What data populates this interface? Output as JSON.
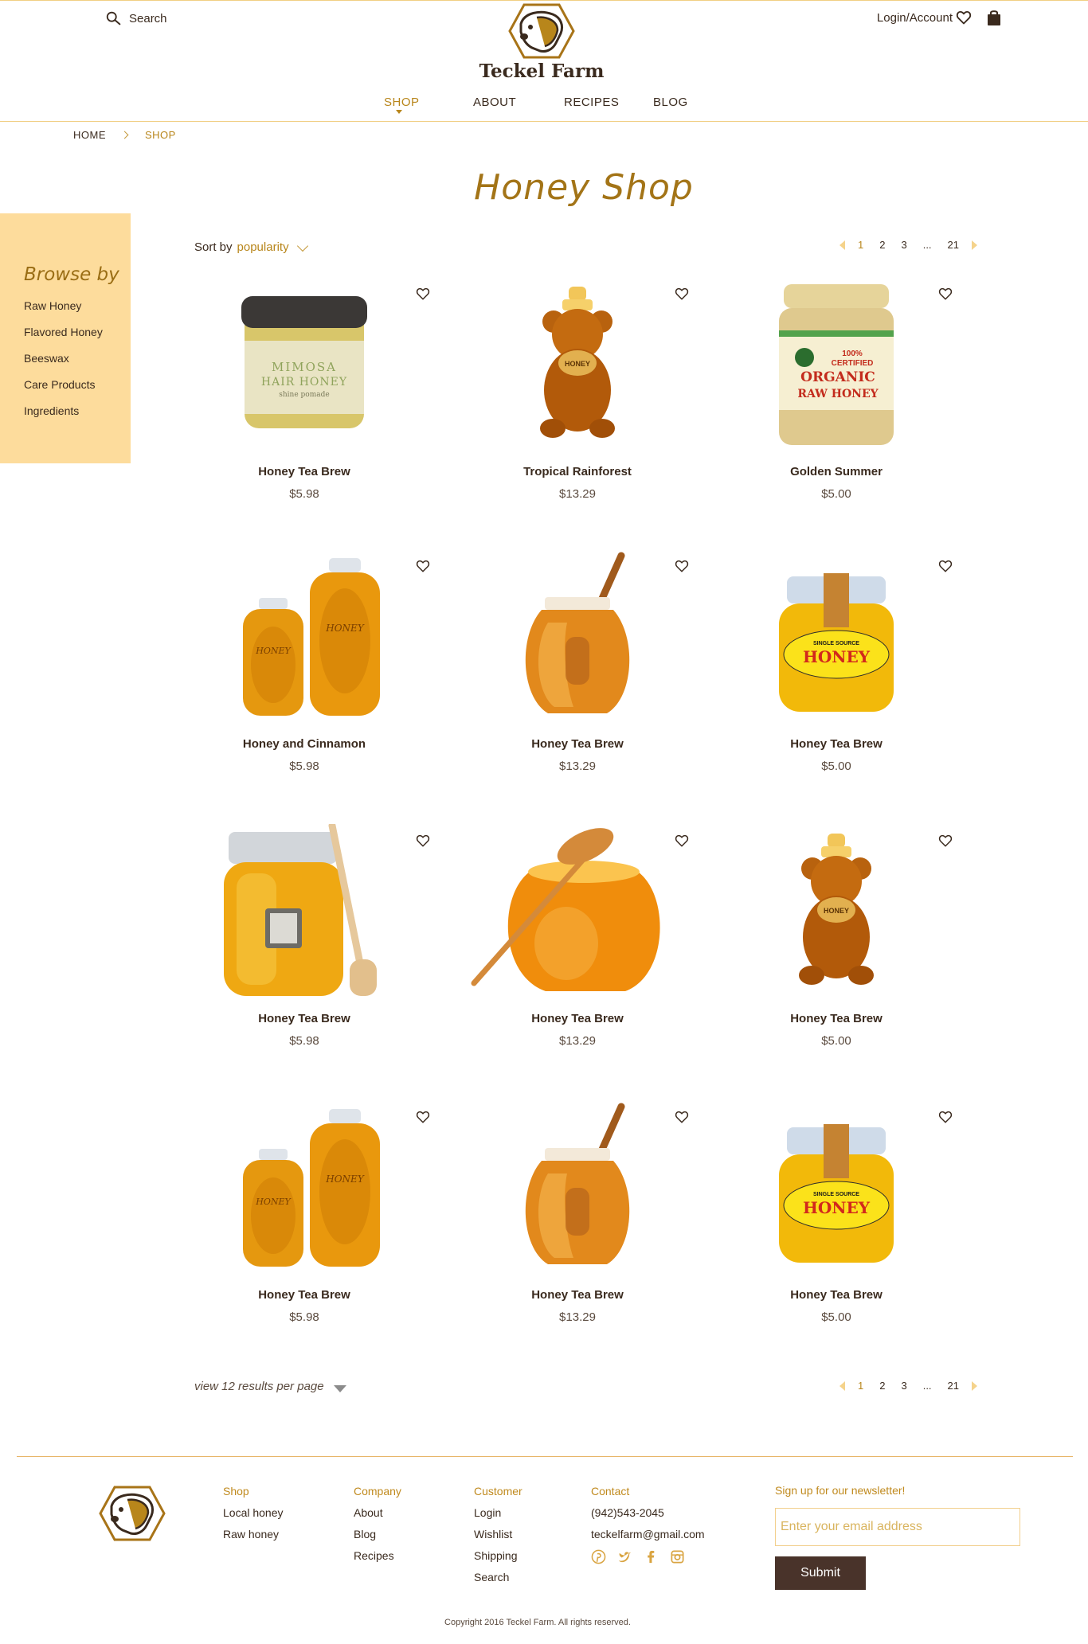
{
  "header": {
    "search_label": "Search",
    "brand": "Teckel Farm",
    "account_label": "Login/Account"
  },
  "nav": [
    {
      "label": "SHOP",
      "active": true
    },
    {
      "label": "ABOUT"
    },
    {
      "label": "RECIPES"
    },
    {
      "label": "BLOG"
    }
  ],
  "breadcrumb": {
    "home": "HOME",
    "current": "SHOP"
  },
  "page_title": "Honey Shop",
  "sidebar": {
    "title": "Browse by",
    "items": [
      "Raw Honey",
      "Flavored Honey",
      "Beeswax",
      "Care Products",
      "Ingredients"
    ]
  },
  "sort": {
    "label": "Sort by",
    "value": "popularity"
  },
  "pager": {
    "pages": [
      "1",
      "2",
      "3",
      "...",
      "21"
    ],
    "current": "1"
  },
  "products": [
    {
      "name": "Honey Tea Brew",
      "price": "$5.98",
      "image": "mimosa-hair-honey-jar",
      "image_text": [
        "MIMOSA",
        "HAIR HONEY",
        "shine pomade"
      ]
    },
    {
      "name": "Tropical Rainforest",
      "price": "$13.29",
      "image": "honey-bear-bottle",
      "image_text": [
        "HONEY"
      ]
    },
    {
      "name": "Golden Summer",
      "price": "$5.00",
      "image": "organic-honey-jar",
      "image_text": [
        "100%",
        "CERTIFIED",
        "ORGANIC",
        "RAW HONEY"
      ]
    },
    {
      "name": "Honey and Cinnamon",
      "price": "$5.98",
      "image": "two-honey-bottles",
      "image_text": [
        "HONEY",
        "HONEY"
      ]
    },
    {
      "name": "Honey Tea Brew",
      "price": "$13.29",
      "image": "honey-pot-dipper",
      "image_text": []
    },
    {
      "name": "Honey Tea Brew",
      "price": "$5.00",
      "image": "single-source-honey-jar",
      "image_text": [
        "SINGLE SOURCE",
        "HONEY"
      ]
    },
    {
      "name": "Honey Tea Brew",
      "price": "$5.98",
      "image": "square-jar-with-dipper",
      "image_text": []
    },
    {
      "name": "Honey Tea Brew",
      "price": "$13.29",
      "image": "round-jar-with-dipper",
      "image_text": []
    },
    {
      "name": "Honey Tea Brew",
      "price": "$5.00",
      "image": "honey-bear-bottle",
      "image_text": [
        "HONEY"
      ]
    },
    {
      "name": "Honey Tea Brew",
      "price": "$5.98",
      "image": "two-honey-bottles",
      "image_text": [
        "HONEY",
        "HONEY"
      ]
    },
    {
      "name": "Honey Tea Brew",
      "price": "$13.29",
      "image": "honey-pot-dipper",
      "image_text": []
    },
    {
      "name": "Honey Tea Brew",
      "price": "$5.00",
      "image": "single-source-honey-jar",
      "image_text": [
        "SINGLE SOURCE",
        "HONEY"
      ]
    }
  ],
  "per_page": "view 12 results per page",
  "footer": {
    "columns": [
      {
        "heading": "Shop",
        "links": [
          "Local honey",
          "Raw honey"
        ]
      },
      {
        "heading": "Company",
        "links": [
          "About",
          "Blog",
          "Recipes"
        ]
      },
      {
        "heading": "Customer",
        "links": [
          "Login",
          "Wishlist",
          "Shipping",
          "Search"
        ]
      }
    ],
    "contact": {
      "heading": "Contact",
      "phone": "(942)543-2045",
      "email": "teckelfarm@gmail.com"
    },
    "social_icons": [
      "pinterest-icon",
      "twitter-icon",
      "facebook-icon",
      "instagram-icon"
    ],
    "newsletter": {
      "heading": "Sign up for our newsletter!",
      "placeholder": "Enter your email address",
      "submit": "Submit"
    },
    "copyright": "Copyright 2016 Teckel Farm. All rights reserved."
  },
  "colors": {
    "accent": "#b8861b",
    "sidebar_bg": "#fddc9c",
    "dark": "#3a2a1e",
    "button": "#49332a"
  }
}
